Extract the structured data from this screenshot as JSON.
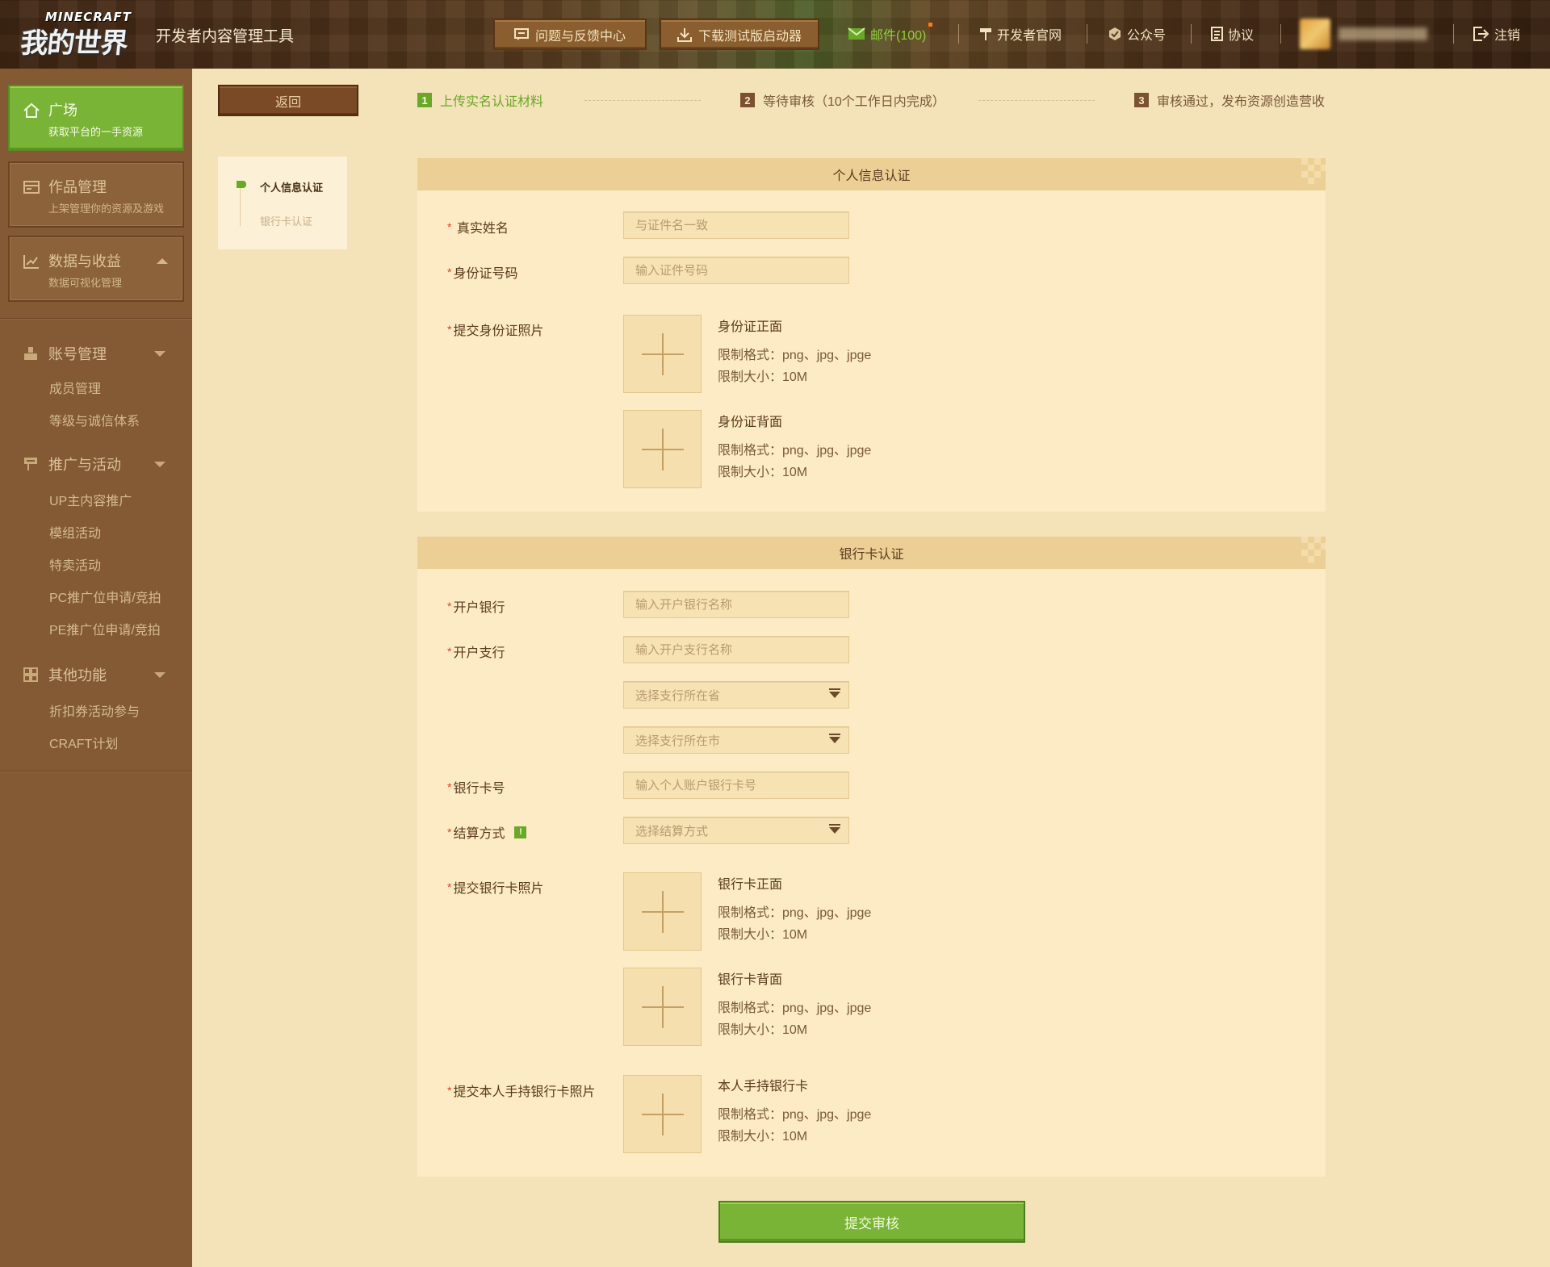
{
  "header": {
    "logo_top": "MINECRAFT",
    "logo_main": "我的世界",
    "app_title": "开发者内容管理工具",
    "feedback_btn": "问题与反馈中心",
    "download_btn": "下载测试版启动器",
    "mail_label": "邮件(100)",
    "dev_site": "开发者官网",
    "wechat": "公众号",
    "protocol": "协议",
    "logout": "注销"
  },
  "sidebar": {
    "cards": [
      {
        "title": "广场",
        "sub": "获取平台的一手资源",
        "icon": "home-icon"
      },
      {
        "title": "作品管理",
        "sub": "上架管理你的资源及游戏",
        "icon": "folder-icon"
      },
      {
        "title": "数据与收益",
        "sub": "数据可视化管理",
        "icon": "chart-icon"
      }
    ],
    "groups": [
      {
        "title": "账号管理",
        "items": [
          "成员管理",
          "等级与诚信体系"
        ]
      },
      {
        "title": "推广与活动",
        "items": [
          "UP主内容推广",
          "模组活动",
          "特卖活动",
          "PC推广位申请/竞拍",
          "PE推广位申请/竞拍"
        ]
      },
      {
        "title": "其他功能",
        "items": [
          "折扣券活动参与",
          "CRAFT计划"
        ]
      }
    ]
  },
  "main": {
    "back_label": "返回",
    "steps": [
      {
        "num": "1",
        "label": "上传实名认证材料"
      },
      {
        "num": "2",
        "label": "等待审核（10个工作日内完成）"
      },
      {
        "num": "3",
        "label": "审核通过，发布资源创造营收"
      }
    ],
    "side_tabs": [
      "个人信息认证",
      "银行卡认证"
    ],
    "personal": {
      "title": "个人信息认证",
      "name_label": "真实姓名",
      "name_placeholder": "与证件名一致",
      "id_label": "身份证号码",
      "id_placeholder": "输入证件号码",
      "photo_label": "提交身份证照片",
      "uploads": [
        {
          "title": "身份证正面",
          "format": "限制格式：png、jpg、jpge",
          "size": "限制大小：10M"
        },
        {
          "title": "身份证背面",
          "format": "限制格式：png、jpg、jpge",
          "size": "限制大小：10M"
        }
      ]
    },
    "bank": {
      "title": "银行卡认证",
      "bank_label": "开户银行",
      "bank_placeholder": "输入开户银行名称",
      "branch_label": "开户支行",
      "branch_placeholder": "输入开户支行名称",
      "province_placeholder": "选择支行所在省",
      "city_placeholder": "选择支行所在市",
      "card_label": "银行卡号",
      "card_placeholder": "输入个人账户银行卡号",
      "settle_label": "结算方式",
      "settle_placeholder": "选择结算方式",
      "photo_label": "提交银行卡照片",
      "hand_label": "提交本人手持银行卡照片",
      "uploads": [
        {
          "title": "银行卡正面",
          "format": "限制格式：png、jpg、jpge",
          "size": "限制大小：10M"
        },
        {
          "title": "银行卡背面",
          "format": "限制格式：png、jpg、jpge",
          "size": "限制大小：10M"
        },
        {
          "title": "本人手持银行卡",
          "format": "限制格式：png、jpg、jpge",
          "size": "限制大小：10M"
        }
      ]
    },
    "submit_label": "提交审核"
  },
  "colors": {
    "accent": "#7ab436",
    "sidebar": "#835a34",
    "panel": "#fcebc4",
    "page_bg": "#f4e2b8"
  }
}
